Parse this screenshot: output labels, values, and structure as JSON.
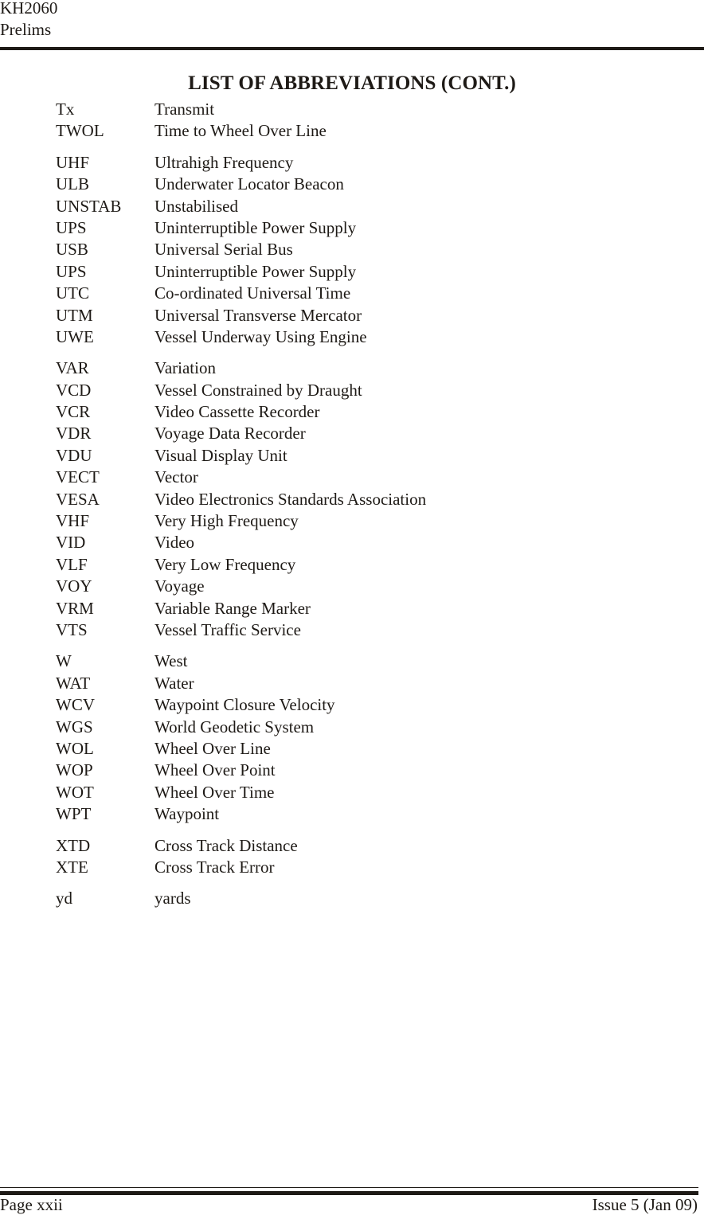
{
  "header": {
    "doc_id": "KH2060",
    "section": "Prelims"
  },
  "title": "LIST OF ABBREVIATIONS (CONT.)",
  "groups": [
    {
      "entries": [
        {
          "abbr": "Tx",
          "definition": "Transmit"
        },
        {
          "abbr": "TWOL",
          "definition": "Time to Wheel Over Line"
        }
      ]
    },
    {
      "entries": [
        {
          "abbr": "UHF",
          "definition": "Ultrahigh Frequency"
        },
        {
          "abbr": "ULB",
          "definition": "Underwater Locator Beacon"
        },
        {
          "abbr": "UNSTAB",
          "definition": "Unstabilised"
        },
        {
          "abbr": "UPS",
          "definition": "Uninterruptible Power Supply"
        },
        {
          "abbr": "USB",
          "definition": "Universal Serial Bus"
        },
        {
          "abbr": "UPS",
          "definition": "Uninterruptible Power Supply"
        },
        {
          "abbr": "UTC",
          "definition": "Co-ordinated Universal Time"
        },
        {
          "abbr": "UTM",
          "definition": "Universal Transverse Mercator"
        },
        {
          "abbr": "UWE",
          "definition": "Vessel Underway Using Engine"
        }
      ]
    },
    {
      "entries": [
        {
          "abbr": "VAR",
          "definition": "Variation"
        },
        {
          "abbr": "VCD",
          "definition": "Vessel Constrained by Draught"
        },
        {
          "abbr": "VCR",
          "definition": "Video Cassette Recorder"
        },
        {
          "abbr": "VDR",
          "definition": "Voyage Data Recorder"
        },
        {
          "abbr": "VDU",
          "definition": "Visual Display Unit"
        },
        {
          "abbr": "VECT",
          "definition": "Vector"
        },
        {
          "abbr": "VESA",
          "definition": "Video Electronics Standards Association"
        },
        {
          "abbr": "VHF",
          "definition": "Very High Frequency"
        },
        {
          "abbr": "VID",
          "definition": "Video"
        },
        {
          "abbr": "VLF",
          "definition": "Very Low Frequency"
        },
        {
          "abbr": "VOY",
          "definition": "Voyage"
        },
        {
          "abbr": "VRM",
          "definition": "Variable Range Marker"
        },
        {
          "abbr": "VTS",
          "definition": "Vessel Traffic Service"
        }
      ]
    },
    {
      "entries": [
        {
          "abbr": "W",
          "definition": "West"
        },
        {
          "abbr": "WAT",
          "definition": "Water"
        },
        {
          "abbr": "WCV",
          "definition": "Waypoint Closure Velocity"
        },
        {
          "abbr": "WGS",
          "definition": "World Geodetic System"
        },
        {
          "abbr": "WOL",
          "definition": "Wheel Over Line"
        },
        {
          "abbr": "WOP",
          "definition": "Wheel Over Point"
        },
        {
          "abbr": "WOT",
          "definition": "Wheel Over Time"
        },
        {
          "abbr": "WPT",
          "definition": "Waypoint"
        }
      ]
    },
    {
      "entries": [
        {
          "abbr": "XTD",
          "definition": "Cross Track Distance"
        },
        {
          "abbr": "XTE",
          "definition": "Cross Track Error"
        }
      ]
    },
    {
      "entries": [
        {
          "abbr": "yd",
          "definition": "yards"
        }
      ]
    }
  ],
  "footer": {
    "page": "Page xxii",
    "issue": "Issue 5 (Jan 09)"
  }
}
